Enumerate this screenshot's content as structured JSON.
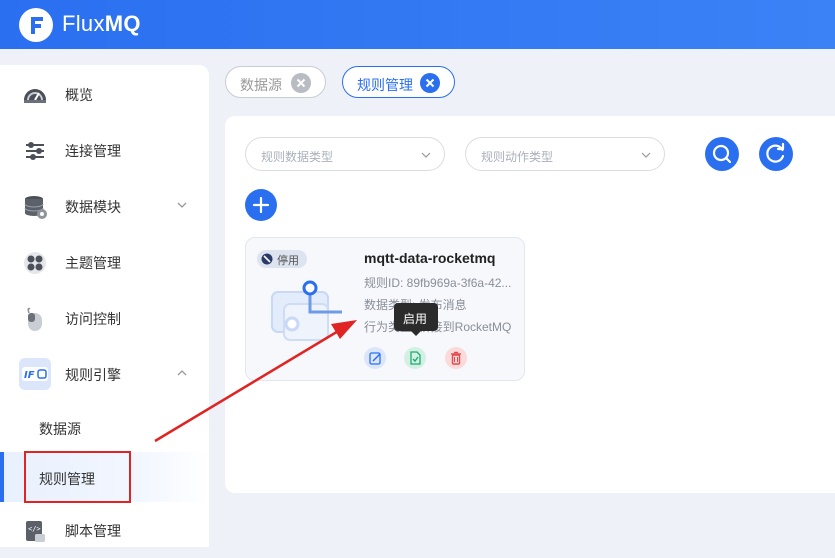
{
  "app": {
    "logo_prefix": "Flux",
    "logo_suffix": "MQ"
  },
  "sidebar": {
    "items": [
      {
        "label": "概览",
        "icon": "dashboard-gauge-icon"
      },
      {
        "label": "连接管理",
        "icon": "connection-sliders-icon"
      },
      {
        "label": "数据模块",
        "icon": "database-icon"
      },
      {
        "label": "主题管理",
        "icon": "topic-cluster-icon"
      },
      {
        "label": "访问控制",
        "icon": "mouse-icon"
      },
      {
        "label": "规则引擎",
        "icon": "rule-engine-icon"
      },
      {
        "label": "脚本管理",
        "icon": "script-icon"
      }
    ],
    "sub_items": [
      {
        "label": "数据源"
      },
      {
        "label": "规则管理",
        "active": true
      }
    ]
  },
  "tabs": [
    {
      "label": "数据源",
      "active": false
    },
    {
      "label": "规则管理",
      "active": true
    }
  ],
  "filters": {
    "rule_data_type_placeholder": "规则数据类型",
    "rule_action_type_placeholder": "规则动作类型"
  },
  "card": {
    "status": "停用",
    "title": "mqtt-data-rocketmq",
    "rule_id": "规则ID: 89fb969a-3f6a-42...",
    "data_type": "数据类型: 发布消息",
    "action_type": "行为类型: 桥接到RocketMQ",
    "tooltip": "启用"
  },
  "colors": {
    "primary": "#2a6ff0",
    "danger": "#e02424",
    "edit_bg": "#dbe6fb",
    "enable_bg": "#d3f0e3",
    "delete_bg": "#fbdada"
  }
}
